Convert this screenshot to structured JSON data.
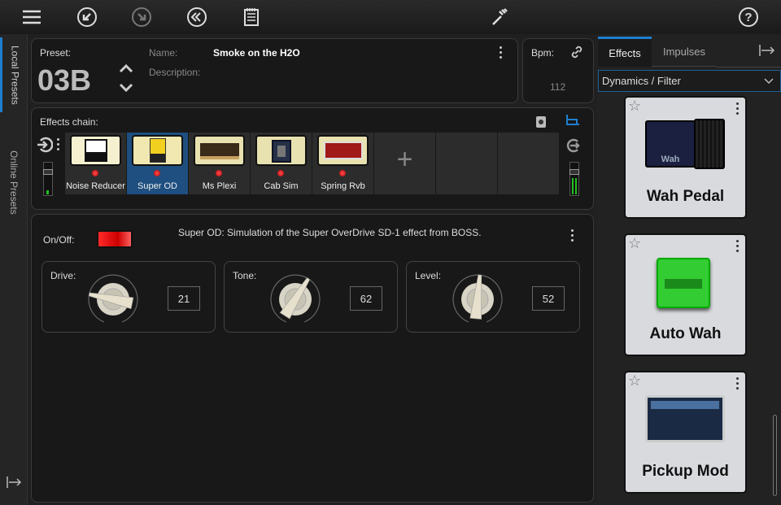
{
  "toolbar": {
    "icons": [
      "menu-icon",
      "undo-icon",
      "redo-icon",
      "revert-icon",
      "notes-icon",
      "tuner-icon",
      "help-icon"
    ]
  },
  "sidebar": {
    "tabs": [
      {
        "label": "Local Presets",
        "active": true
      },
      {
        "label": "Online Presets",
        "active": false
      }
    ]
  },
  "preset": {
    "label": "Preset:",
    "number": "03B",
    "name_label": "Name:",
    "name": "Smoke on the H2O",
    "description_label": "Description:",
    "description": ""
  },
  "bpm": {
    "label": "Bpm:",
    "value": "112"
  },
  "chain": {
    "label": "Effects chain:",
    "slots": [
      {
        "name": "Noise Reducer",
        "selected": false
      },
      {
        "name": "Super OD",
        "selected": true
      },
      {
        "name": "Ms Plexi",
        "selected": false
      },
      {
        "name": "Cab Sim",
        "selected": false
      },
      {
        "name": "Spring Rvb",
        "selected": false
      }
    ],
    "add_label": "+"
  },
  "effect": {
    "onoff_label": "On/Off:",
    "on": true,
    "description": "Super OD:  Simulation of the Super OverDrive SD-1 effect from BOSS.",
    "knobs": [
      {
        "label": "Drive:",
        "value": "21"
      },
      {
        "label": "Tone:",
        "value": "62"
      },
      {
        "label": "Level:",
        "value": "52"
      }
    ]
  },
  "library": {
    "tabs": [
      {
        "label": "Effects",
        "active": true
      },
      {
        "label": "Impulses",
        "active": false
      }
    ],
    "category": "Dynamics / Filter",
    "cards": [
      {
        "title": "Wah Pedal"
      },
      {
        "title": "Auto Wah"
      },
      {
        "title": "Pickup Mod"
      }
    ]
  },
  "colors": {
    "accent": "#1e7fd0",
    "selected_slot": "#1e4f80",
    "led": "#ff2020",
    "meter": "#22c022"
  }
}
